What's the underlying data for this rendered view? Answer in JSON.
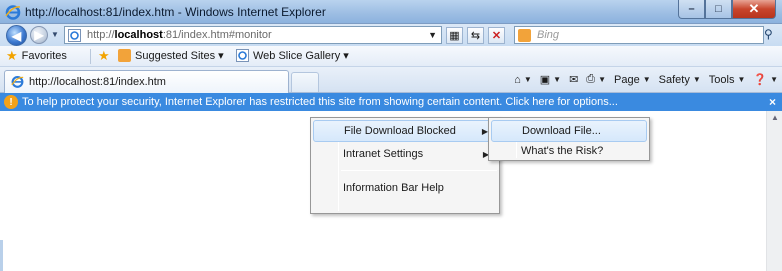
{
  "window": {
    "title": "http://localhost:81/index.htm - Windows Internet Explorer",
    "minimize": "–",
    "maximize": "□",
    "close": "✕"
  },
  "navbar": {
    "url_prefix": "http://",
    "url_host": "localhost",
    "url_rest": ":81/index.htm#monitor",
    "search_placeholder": "Bing"
  },
  "favorites": {
    "label": "Favorites",
    "items": [
      {
        "label": "Suggested Sites ▾",
        "icon": "suggested-sites-icon"
      },
      {
        "label": "Web Slice Gallery ▾",
        "icon": "ie-page-icon"
      }
    ]
  },
  "tab": {
    "title": "http://localhost:81/index.htm"
  },
  "commandbar": {
    "page": "Page",
    "safety": "Safety",
    "tools": "Tools"
  },
  "infobar": {
    "message": "To help protect your security, Internet Explorer has restricted this site from showing certain content. Click here for options...",
    "close": "×"
  },
  "menu": {
    "items": [
      {
        "label": "File Download Blocked",
        "submenu": true
      },
      {
        "label": "Intranet Settings",
        "submenu": true
      },
      {
        "label": "Information Bar Help",
        "submenu": false
      }
    ],
    "submenu": [
      {
        "label": "Download File..."
      },
      {
        "label": "What's the Risk?"
      }
    ]
  },
  "colors": {
    "infobar": "#3a8ae0",
    "title_gradient": "#9cbde3"
  }
}
